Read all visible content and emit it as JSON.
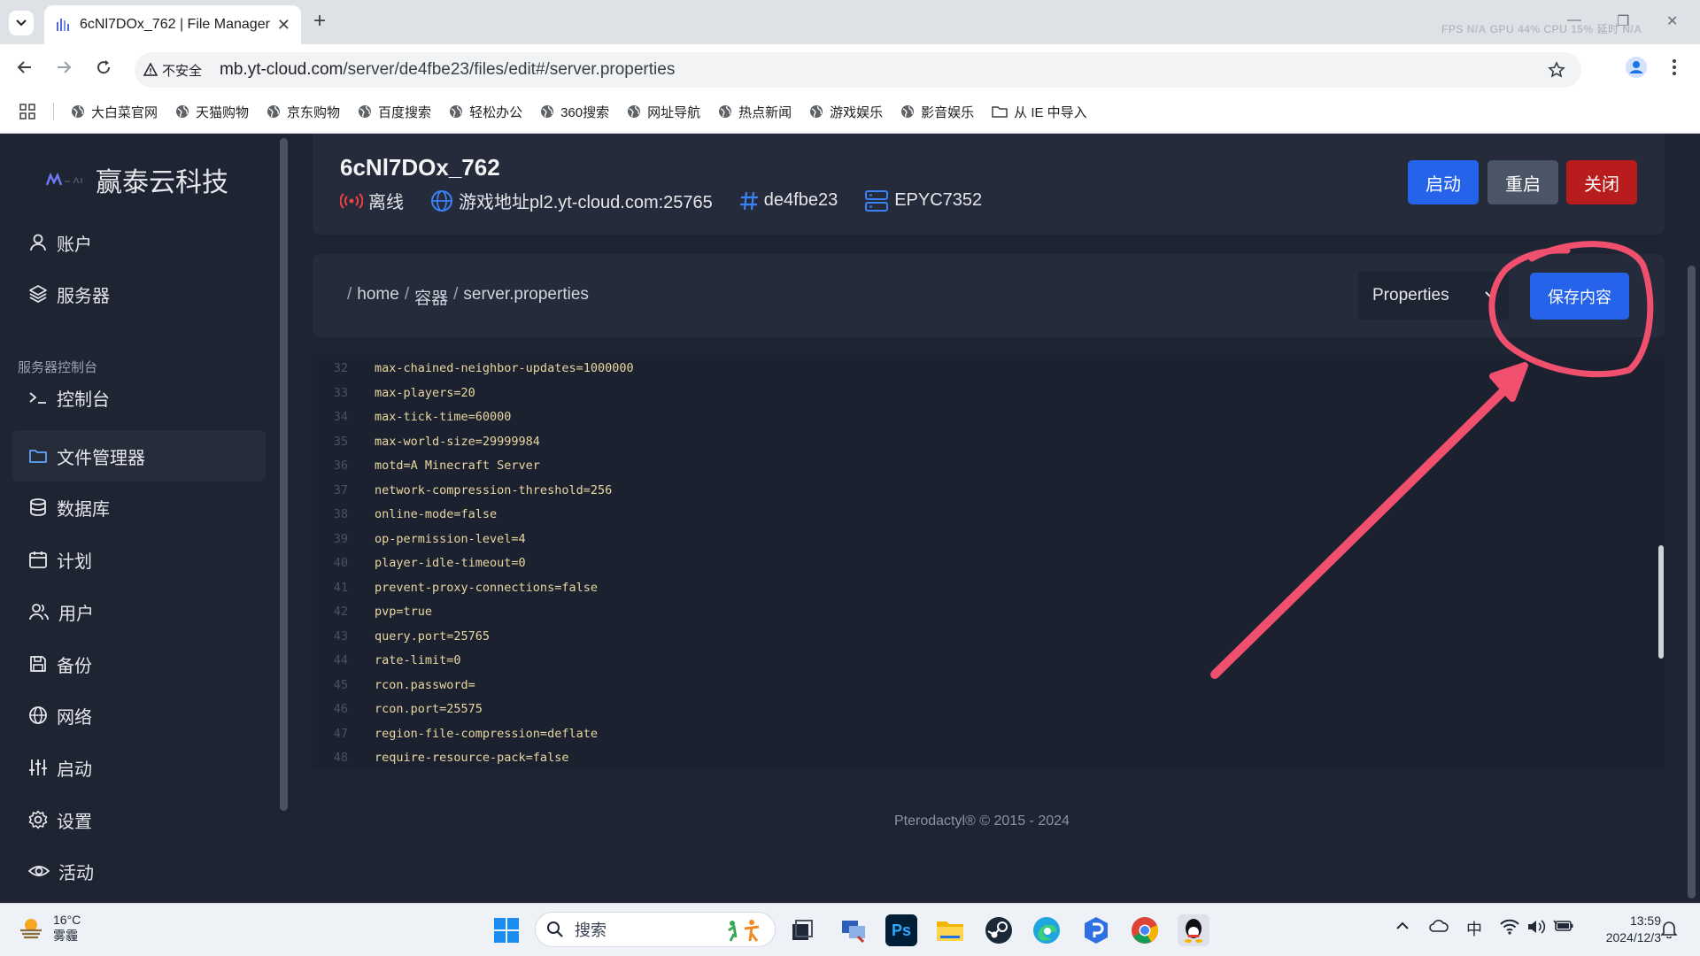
{
  "browser": {
    "tab_title": "6cNl7DOx_762 | File Manager",
    "overlay_stats": {
      "fps_label": "FPS",
      "fps_value": "N/A",
      "gpu_label": "GPU",
      "gpu_value": "44%",
      "cpu_label": "CPU",
      "cpu_value": "15%",
      "lat_label": "延时",
      "lat_value": "N/A"
    },
    "insecure_label": "不安全",
    "url_host": "mb.yt-cloud.com",
    "url_path": "/server/de4fbe23/files/edit#/server.properties",
    "bookmarks": [
      "大白菜官网",
      "天猫购物",
      "京东购物",
      "百度搜索",
      "轻松办公",
      "360搜索",
      "网址导航",
      "热点新闻",
      "游戏娱乐",
      "影音娱乐"
    ],
    "bookmark_folder": "从 IE 中导入"
  },
  "sidebar": {
    "brand": "赢泰云科技",
    "items_top": [
      "账户",
      "服务器"
    ],
    "section_label": "服务器控制台",
    "items": [
      "控制台",
      "文件管理器",
      "数据库",
      "计划",
      "用户",
      "备份",
      "网络",
      "启动",
      "设置",
      "活动"
    ],
    "active_item": "文件管理器"
  },
  "server": {
    "name": "6cNl7DOx_762",
    "status": "离线",
    "address": "游戏地址pl2.yt-cloud.com:25765",
    "id": "de4fbe23",
    "node": "EPYC7352",
    "buttons": {
      "start": "启动",
      "restart": "重启",
      "stop": "关闭"
    }
  },
  "file": {
    "breadcrumb": [
      "/",
      "home",
      "/",
      "容器",
      "/",
      "server.properties"
    ],
    "language": "Properties",
    "save_label": "保存内容",
    "lines": [
      {
        "n": "32",
        "text": "max-chained-neighbor-updates=1000000"
      },
      {
        "n": "33",
        "text": "max-players=20"
      },
      {
        "n": "34",
        "text": "max-tick-time=60000"
      },
      {
        "n": "35",
        "text": "max-world-size=29999984"
      },
      {
        "n": "36",
        "text": "motd=A Minecraft Server"
      },
      {
        "n": "37",
        "text": "network-compression-threshold=256"
      },
      {
        "n": "38",
        "text": "online-mode=false"
      },
      {
        "n": "39",
        "text": "op-permission-level=4"
      },
      {
        "n": "40",
        "text": "player-idle-timeout=0"
      },
      {
        "n": "41",
        "text": "prevent-proxy-connections=false"
      },
      {
        "n": "42",
        "text": "pvp=true"
      },
      {
        "n": "43",
        "text": "query.port=25765"
      },
      {
        "n": "44",
        "text": "rate-limit=0"
      },
      {
        "n": "45",
        "text": "rcon.password="
      },
      {
        "n": "46",
        "text": "rcon.port=25575"
      },
      {
        "n": "47",
        "text": "region-file-compression=deflate"
      },
      {
        "n": "48",
        "text": "require-resource-pack=false"
      }
    ]
  },
  "footer": "Pterodactyl® © 2015 - 2024",
  "taskbar": {
    "temp": "16°C",
    "weather": "雾霾",
    "search_placeholder": "搜索",
    "ime": "中",
    "time": "13:59",
    "date": "2024/12/3"
  },
  "colors": {
    "accent": "#2563eb",
    "danger": "#b91c1c",
    "secondary": "#4b5568",
    "annotation": "#f0506e"
  }
}
